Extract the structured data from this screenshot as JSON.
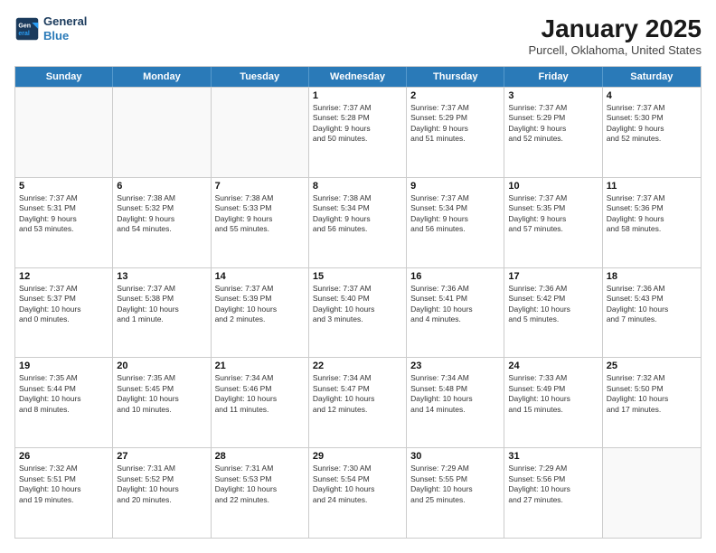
{
  "header": {
    "logo_line1": "General",
    "logo_line2": "Blue",
    "month": "January 2025",
    "location": "Purcell, Oklahoma, United States"
  },
  "days_of_week": [
    "Sunday",
    "Monday",
    "Tuesday",
    "Wednesday",
    "Thursday",
    "Friday",
    "Saturday"
  ],
  "weeks": [
    [
      {
        "day": "",
        "info": ""
      },
      {
        "day": "",
        "info": ""
      },
      {
        "day": "",
        "info": ""
      },
      {
        "day": "1",
        "info": "Sunrise: 7:37 AM\nSunset: 5:28 PM\nDaylight: 9 hours\nand 50 minutes."
      },
      {
        "day": "2",
        "info": "Sunrise: 7:37 AM\nSunset: 5:29 PM\nDaylight: 9 hours\nand 51 minutes."
      },
      {
        "day": "3",
        "info": "Sunrise: 7:37 AM\nSunset: 5:29 PM\nDaylight: 9 hours\nand 52 minutes."
      },
      {
        "day": "4",
        "info": "Sunrise: 7:37 AM\nSunset: 5:30 PM\nDaylight: 9 hours\nand 52 minutes."
      }
    ],
    [
      {
        "day": "5",
        "info": "Sunrise: 7:37 AM\nSunset: 5:31 PM\nDaylight: 9 hours\nand 53 minutes."
      },
      {
        "day": "6",
        "info": "Sunrise: 7:38 AM\nSunset: 5:32 PM\nDaylight: 9 hours\nand 54 minutes."
      },
      {
        "day": "7",
        "info": "Sunrise: 7:38 AM\nSunset: 5:33 PM\nDaylight: 9 hours\nand 55 minutes."
      },
      {
        "day": "8",
        "info": "Sunrise: 7:38 AM\nSunset: 5:34 PM\nDaylight: 9 hours\nand 56 minutes."
      },
      {
        "day": "9",
        "info": "Sunrise: 7:37 AM\nSunset: 5:34 PM\nDaylight: 9 hours\nand 56 minutes."
      },
      {
        "day": "10",
        "info": "Sunrise: 7:37 AM\nSunset: 5:35 PM\nDaylight: 9 hours\nand 57 minutes."
      },
      {
        "day": "11",
        "info": "Sunrise: 7:37 AM\nSunset: 5:36 PM\nDaylight: 9 hours\nand 58 minutes."
      }
    ],
    [
      {
        "day": "12",
        "info": "Sunrise: 7:37 AM\nSunset: 5:37 PM\nDaylight: 10 hours\nand 0 minutes."
      },
      {
        "day": "13",
        "info": "Sunrise: 7:37 AM\nSunset: 5:38 PM\nDaylight: 10 hours\nand 1 minute."
      },
      {
        "day": "14",
        "info": "Sunrise: 7:37 AM\nSunset: 5:39 PM\nDaylight: 10 hours\nand 2 minutes."
      },
      {
        "day": "15",
        "info": "Sunrise: 7:37 AM\nSunset: 5:40 PM\nDaylight: 10 hours\nand 3 minutes."
      },
      {
        "day": "16",
        "info": "Sunrise: 7:36 AM\nSunset: 5:41 PM\nDaylight: 10 hours\nand 4 minutes."
      },
      {
        "day": "17",
        "info": "Sunrise: 7:36 AM\nSunset: 5:42 PM\nDaylight: 10 hours\nand 5 minutes."
      },
      {
        "day": "18",
        "info": "Sunrise: 7:36 AM\nSunset: 5:43 PM\nDaylight: 10 hours\nand 7 minutes."
      }
    ],
    [
      {
        "day": "19",
        "info": "Sunrise: 7:35 AM\nSunset: 5:44 PM\nDaylight: 10 hours\nand 8 minutes."
      },
      {
        "day": "20",
        "info": "Sunrise: 7:35 AM\nSunset: 5:45 PM\nDaylight: 10 hours\nand 10 minutes."
      },
      {
        "day": "21",
        "info": "Sunrise: 7:34 AM\nSunset: 5:46 PM\nDaylight: 10 hours\nand 11 minutes."
      },
      {
        "day": "22",
        "info": "Sunrise: 7:34 AM\nSunset: 5:47 PM\nDaylight: 10 hours\nand 12 minutes."
      },
      {
        "day": "23",
        "info": "Sunrise: 7:34 AM\nSunset: 5:48 PM\nDaylight: 10 hours\nand 14 minutes."
      },
      {
        "day": "24",
        "info": "Sunrise: 7:33 AM\nSunset: 5:49 PM\nDaylight: 10 hours\nand 15 minutes."
      },
      {
        "day": "25",
        "info": "Sunrise: 7:32 AM\nSunset: 5:50 PM\nDaylight: 10 hours\nand 17 minutes."
      }
    ],
    [
      {
        "day": "26",
        "info": "Sunrise: 7:32 AM\nSunset: 5:51 PM\nDaylight: 10 hours\nand 19 minutes."
      },
      {
        "day": "27",
        "info": "Sunrise: 7:31 AM\nSunset: 5:52 PM\nDaylight: 10 hours\nand 20 minutes."
      },
      {
        "day": "28",
        "info": "Sunrise: 7:31 AM\nSunset: 5:53 PM\nDaylight: 10 hours\nand 22 minutes."
      },
      {
        "day": "29",
        "info": "Sunrise: 7:30 AM\nSunset: 5:54 PM\nDaylight: 10 hours\nand 24 minutes."
      },
      {
        "day": "30",
        "info": "Sunrise: 7:29 AM\nSunset: 5:55 PM\nDaylight: 10 hours\nand 25 minutes."
      },
      {
        "day": "31",
        "info": "Sunrise: 7:29 AM\nSunset: 5:56 PM\nDaylight: 10 hours\nand 27 minutes."
      },
      {
        "day": "",
        "info": ""
      }
    ]
  ]
}
